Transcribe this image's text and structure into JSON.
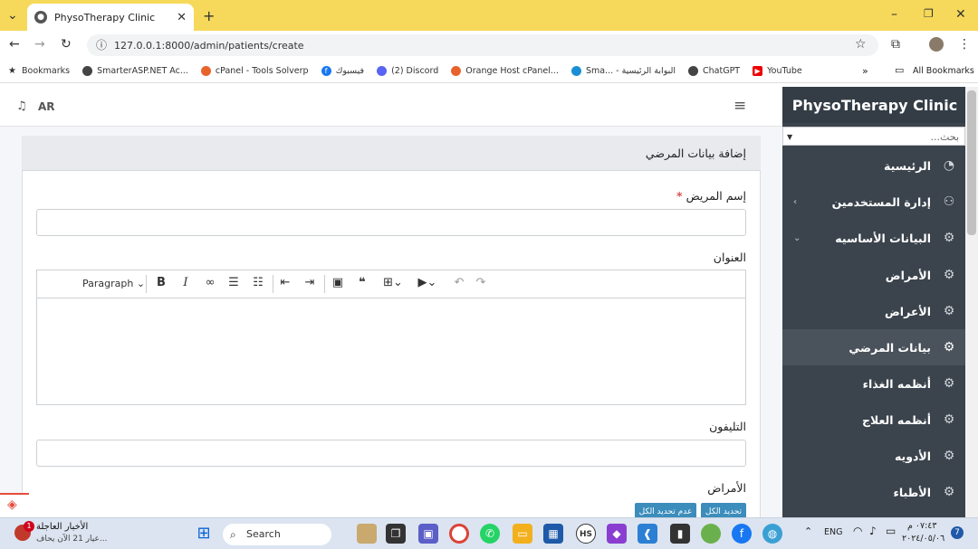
{
  "browser": {
    "tab_title": "PhysoTherapy Clinic",
    "tab_close": "✕",
    "new_tab": "+",
    "url": "127.0.0.1:8000/admin/patients/create",
    "bookmarks": [
      {
        "label": "Bookmarks",
        "color": "#333"
      },
      {
        "label": "SmarterASP.NET Ac...",
        "color": "#444"
      },
      {
        "label": "cPanel - Tools Solverp",
        "color": "#e8632c"
      },
      {
        "label": "فيسبوك",
        "color": "#1877f2"
      },
      {
        "label": "(2) Discord",
        "color": "#5865f2"
      },
      {
        "label": "Orange Host cPanel...",
        "color": "#e8632c"
      },
      {
        "label": "Sma... - البوابة الرئيسية",
        "color": "#1a8fd6"
      },
      {
        "label": "ChatGPT",
        "color": "#444"
      },
      {
        "label": "YouTube",
        "color": "#e00"
      }
    ],
    "more": "»",
    "all_bookmarks": "All Bookmarks"
  },
  "app": {
    "brand": "PhysoTherapy Clinic",
    "lang": "AR",
    "search_placeholder": "بحث...",
    "nav": [
      {
        "label": "الرئيسية"
      },
      {
        "label": "إدارة المستخدمين",
        "chev": "‹"
      },
      {
        "label": "البيانات الأساسيه",
        "chev": "⌄"
      },
      {
        "label": "الأمراض"
      },
      {
        "label": "الأعراض"
      },
      {
        "label": "بيانات المرضي"
      },
      {
        "label": "أنظمه الغذاء"
      },
      {
        "label": "أنظمه العلاج"
      },
      {
        "label": "الأدويه"
      },
      {
        "label": "الأطباء"
      }
    ],
    "card_title": "إضافة بيانات المرضي",
    "form": {
      "name_label": "إسم المريض",
      "required_mark": "*",
      "address_label": "العنوان",
      "paragraph": "Paragraph",
      "phone_label": "التليفون",
      "diseases_label": "الأمراض",
      "select_all": "تحديد الكل",
      "deselect_all": "عدم تحديد الكل"
    }
  },
  "taskbar": {
    "news_title": "الأخبار العاجلة",
    "news_sub": "عيار 21 الآن يحاف...",
    "news_badge": "1",
    "search": "Search",
    "lang": "ENG",
    "time": "٠٧:٤٣ م",
    "date": "٢٠٢٤/٠٥/٠٦",
    "notif": "7"
  }
}
